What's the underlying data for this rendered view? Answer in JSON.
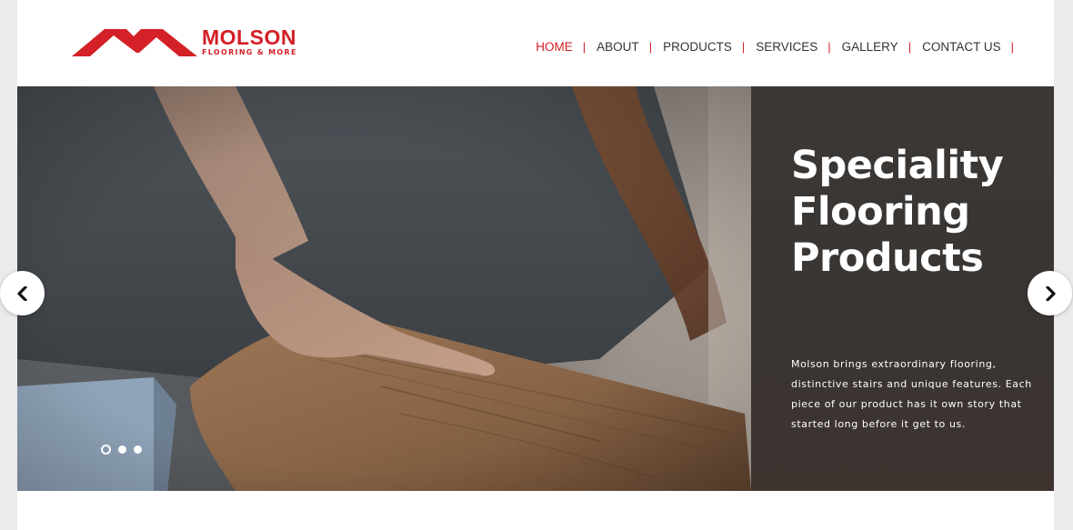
{
  "brand": {
    "name": "MOLSON",
    "tagline": "FLOORING & MORE",
    "color": "#d42027"
  },
  "nav": {
    "items": [
      {
        "label": "HOME",
        "active": true
      },
      {
        "label": "ABOUT",
        "active": false
      },
      {
        "label": "PRODUCTS",
        "active": false
      },
      {
        "label": "SERVICES",
        "active": false
      },
      {
        "label": "GALLERY",
        "active": false
      },
      {
        "label": "CONTACT US",
        "active": false
      }
    ],
    "separator": "|"
  },
  "hero": {
    "title": "Speciality\nFlooring\nProducts",
    "description": "Molson brings extraordinary flooring, distinctive stairs and unique features. Each piece of our product has it own story that started long before it get to us.",
    "slide_count": 3,
    "active_slide": 1,
    "prev_icon": "chevron-left-icon",
    "next_icon": "chevron-right-icon"
  }
}
